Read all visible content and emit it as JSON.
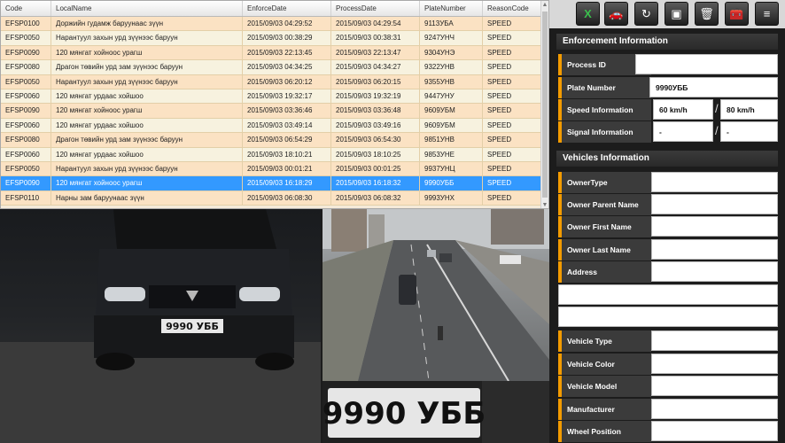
{
  "columns": [
    "Code",
    "LocalName",
    "EnforceDate",
    "ProcessDate",
    "PlateNumber",
    "ReasonCode"
  ],
  "rows": [
    {
      "code": "EFSP0100",
      "name": "Доржийн гудамж баруунаас зүүн",
      "enforce": "2015/09/03 04:29:52",
      "process": "2015/09/03 04:29:54",
      "plate": "9113УБА",
      "reason": "SPEED"
    },
    {
      "code": "EFSP0050",
      "name": "Нарантуул захын урд зүүнээс баруун",
      "enforce": "2015/09/03 00:38:29",
      "process": "2015/09/03 00:38:31",
      "plate": "9247УНЧ",
      "reason": "SPEED"
    },
    {
      "code": "EFSP0090",
      "name": "120 мянгат хойноос урагш",
      "enforce": "2015/09/03 22:13:45",
      "process": "2015/09/03 22:13:47",
      "plate": "9304УНЭ",
      "reason": "SPEED"
    },
    {
      "code": "EFSP0080",
      "name": "Драгон төвийн урд зам зүүнээс баруун",
      "enforce": "2015/09/03 04:34:25",
      "process": "2015/09/03 04:34:27",
      "plate": "9322УНВ",
      "reason": "SPEED"
    },
    {
      "code": "EFSP0050",
      "name": "Нарантуул захын урд зүүнээс баруун",
      "enforce": "2015/09/03 06:20:12",
      "process": "2015/09/03 06:20:15",
      "plate": "9355УНВ",
      "reason": "SPEED"
    },
    {
      "code": "EFSP0060",
      "name": "120 мянгат урдаас хойшоо",
      "enforce": "2015/09/03 19:32:17",
      "process": "2015/09/03 19:32:19",
      "plate": "9447УНУ",
      "reason": "SPEED"
    },
    {
      "code": "EFSP0090",
      "name": "120 мянгат хойноос урагш",
      "enforce": "2015/09/03 03:36:46",
      "process": "2015/09/03 03:36:48",
      "plate": "9609УБМ",
      "reason": "SPEED"
    },
    {
      "code": "EFSP0060",
      "name": "120 мянгат урдаас хойшоо",
      "enforce": "2015/09/03 03:49:14",
      "process": "2015/09/03 03:49:16",
      "plate": "9609УБМ",
      "reason": "SPEED"
    },
    {
      "code": "EFSP0080",
      "name": "Драгон төвийн урд зам зүүнээс баруун",
      "enforce": "2015/09/03 06:54:29",
      "process": "2015/09/03 06:54:30",
      "plate": "9851УНВ",
      "reason": "SPEED"
    },
    {
      "code": "EFSP0060",
      "name": "120 мянгат урдаас хойшоо",
      "enforce": "2015/09/03 18:10:21",
      "process": "2015/09/03 18:10:25",
      "plate": "9853УНЕ",
      "reason": "SPEED"
    },
    {
      "code": "EFSP0050",
      "name": "Нарантуул захын урд зүүнээс баруун",
      "enforce": "2015/09/03 00:01:21",
      "process": "2015/09/03 00:01:25",
      "plate": "9937УНЦ",
      "reason": "SPEED"
    },
    {
      "code": "EFSP0090",
      "name": "120 мянгат хойноос урагш",
      "enforce": "2015/09/03 16:18:29",
      "process": "2015/09/03 16:18:32",
      "plate": "9990УББ",
      "reason": "SPEED"
    },
    {
      "code": "EFSP0110",
      "name": "Нарны зам баруунаас зүүн",
      "enforce": "2015/09/03 06:08:30",
      "process": "2015/09/03 06:08:32",
      "plate": "9993УНХ",
      "reason": "SPEED"
    }
  ],
  "selected_row": 11,
  "toolbar": [
    "excel-icon",
    "car-icon",
    "refresh-icon",
    "save-icon",
    "trash-icon",
    "toolbox-icon",
    "list-icon"
  ],
  "enforcement": {
    "title": "Enforcement Information",
    "process_id_label": "Process ID",
    "process_id": "",
    "plate_label": "Plate Number",
    "plate": "9990УББ",
    "speed_label": "Speed Information",
    "speed_actual": "60 km/h",
    "speed_limit": "80 km/h",
    "signal_label": "Signal Information",
    "signal_a": "-",
    "signal_b": "-"
  },
  "vehicles": {
    "title": "Vehicles Information",
    "owner_type_label": "OwnerType",
    "owner_parent_label": "Owner Parent Name",
    "owner_first_label": "Owner First Name",
    "owner_last_label": "Owner Last Name",
    "address_label": "Address",
    "vehicle_type_label": "Vehicle Type",
    "vehicle_color_label": "Vehicle Color",
    "vehicle_model_label": "Vehicle Model",
    "manufacturer_label": "Manufacturer",
    "wheel_label": "Wheel Position"
  },
  "photos": {
    "front_plate": "9990 УББ",
    "crop_plate": "9990 УББ"
  },
  "colors": {
    "accent": "#f39b00",
    "selection": "#3399ff",
    "row_odd": "#fbe2c3",
    "row_even": "#f7f2df"
  }
}
